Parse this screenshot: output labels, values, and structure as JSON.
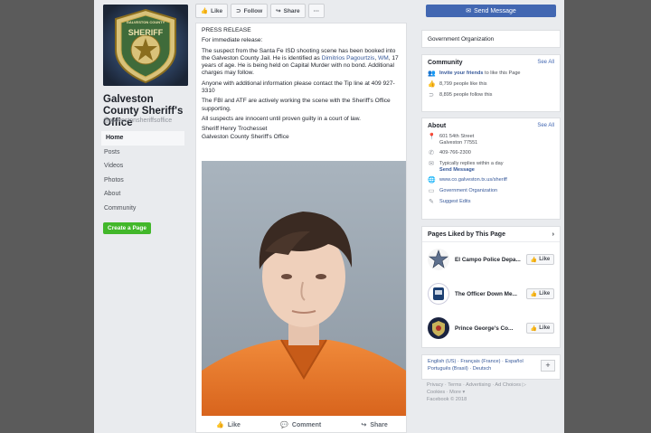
{
  "page": {
    "name": "Galveston County Sheriff's Office",
    "handle": "@galvestonsheriffsoffice",
    "logo_text": "SHERIFF",
    "logo_ring_text": "GALVESTON COUNTY"
  },
  "nav": {
    "items": [
      "Home",
      "Posts",
      "Videos",
      "Photos",
      "About",
      "Community"
    ],
    "create_page": "Create a Page"
  },
  "actions": {
    "like": "Like",
    "follow": "Follow",
    "share": "Share",
    "more": "···"
  },
  "post": {
    "heading": "PRESS RELEASE",
    "line1": "For immediate release:",
    "para1_a": "The suspect from the Santa Fe ISD shooting scene has been booked into the Galveston County Jail. He is identified as ",
    "para1_name": "Dimitrios Pagourtzis",
    "para1_b": ", ",
    "para1_wm": "WM",
    "para1_c": ", 17 years of age. He is being held on Capital Murder with no bond. Additional charges may follow.",
    "para2": "Anyone with additional information please contact the Tip line at 409 927-3310",
    "para3": "The FBI and ATF are actively working the scene with the Sheriff's Office supporting.",
    "para4": "All suspects are innocent until proven guilty in a court of law.",
    "sig1": "Sheriff Henry Trochesset",
    "sig2": "Galveston County Sheriff's Office",
    "like": "Like",
    "comment": "Comment",
    "share": "Share"
  },
  "right": {
    "send_message": "Send Message",
    "category": "Government Organization",
    "community": {
      "title": "Community",
      "see_all": "See All",
      "invite_link": "Invite your friends",
      "invite_rest": " to like this Page",
      "likes": "8,799 people like this",
      "follows": "8,895 people follow this"
    },
    "about": {
      "title": "About",
      "see_all": "See All",
      "address1": "601 54th Street",
      "address2": "Galveston 77551",
      "phone": "409-766-2300",
      "replies": "Typically replies within a day",
      "send_message": "Send Message",
      "website": "www.co.galveston.tx.us/sheriff",
      "category": "Government Organization",
      "suggest": "Suggest Edits"
    },
    "liked": {
      "title": "Pages Liked by This Page",
      "pages": [
        {
          "name": "El Campo Police Depa...",
          "like": "Like"
        },
        {
          "name": "The Officer Down Me...",
          "like": "Like"
        },
        {
          "name": "Prince George's Co...",
          "like": "Like"
        }
      ]
    },
    "languages": {
      "line1": "English (US) · Français (France) · Español",
      "line2": "Português (Brasil) · Deutsch"
    },
    "footer": {
      "line1": "Privacy · Terms · Advertising · Ad Choices ▷",
      "line2": "Cookies · More ▾",
      "line3": "Facebook © 2018"
    }
  },
  "colors": {
    "facebook_blue": "#4267b2",
    "link": "#365899",
    "create_green": "#42b72a",
    "background": "#e9ebee"
  }
}
